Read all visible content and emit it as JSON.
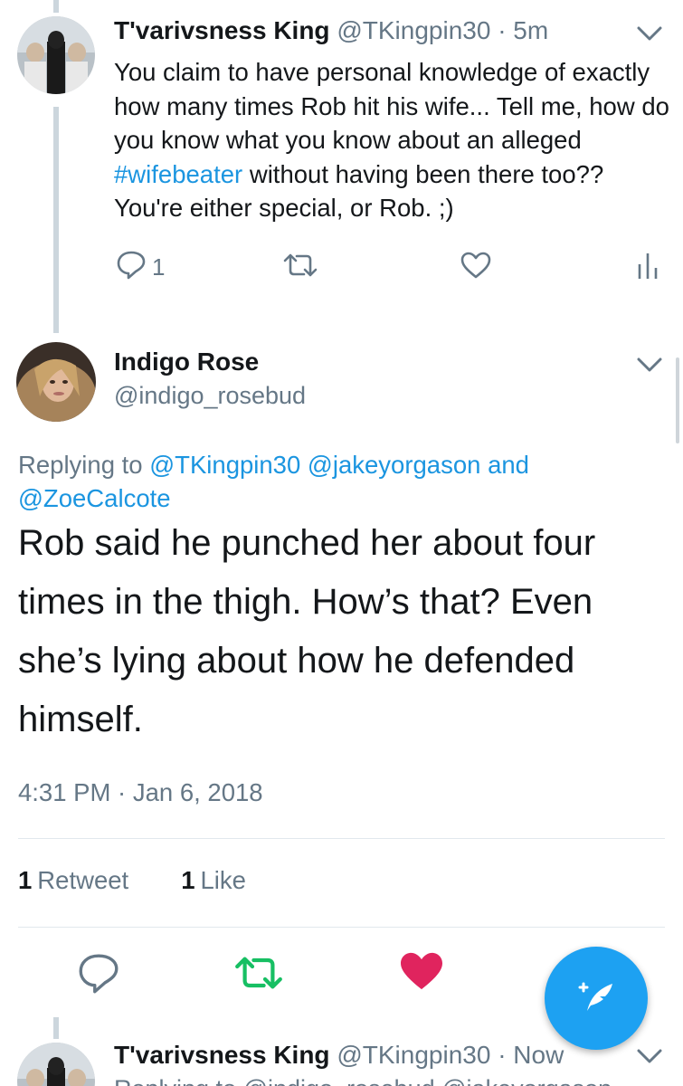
{
  "reply_tweet": {
    "display_name": "T'varivsness King",
    "handle": "@TKingpin30",
    "separator": "·",
    "time": "5m",
    "text_before_hashtag": "You claim to have personal knowledge of exactly how many times Rob hit his wife... Tell me, how do you know what you know about an alleged ",
    "hashtag": "#wifebeater",
    "text_after_hashtag": " without having been there too?? You're either special, or Rob. ;)",
    "reply_count": "1"
  },
  "main_tweet": {
    "display_name": "Indigo Rose",
    "handle": "@indigo_rosebud",
    "replying_prefix": "Replying to",
    "mention_1": "@TKingpin30",
    "mention_2": "@jakeyorgason",
    "mention_and": "and",
    "mention_3": "@ZoeCalcote",
    "text": "Rob said he punched her about four times in the thigh. How’s that? Even she’s lying about how he defended himself.",
    "timestamp": "4:31 PM · Jan 6, 2018",
    "retweet_count": "1",
    "retweet_label": "Retweet",
    "like_count": "1",
    "like_label": "Like"
  },
  "bottom_tweet": {
    "display_name": "T'varivsness King",
    "handle": "@TKingpin30",
    "separator": "·",
    "time": "Now",
    "partial_text": "Replying to @indigo_rosebud @jakeyorgason"
  },
  "icons": {
    "reply": "reply-icon",
    "retweet": "retweet-icon",
    "like": "heart-icon",
    "analytics": "analytics-icon",
    "chevron": "chevron-down-icon",
    "compose": "compose-feather-icon"
  },
  "colors": {
    "accent": "#1da1f2",
    "link": "#1b95e0",
    "retweet_active": "#17bf63",
    "like_active": "#e0245e",
    "muted": "#657786"
  }
}
